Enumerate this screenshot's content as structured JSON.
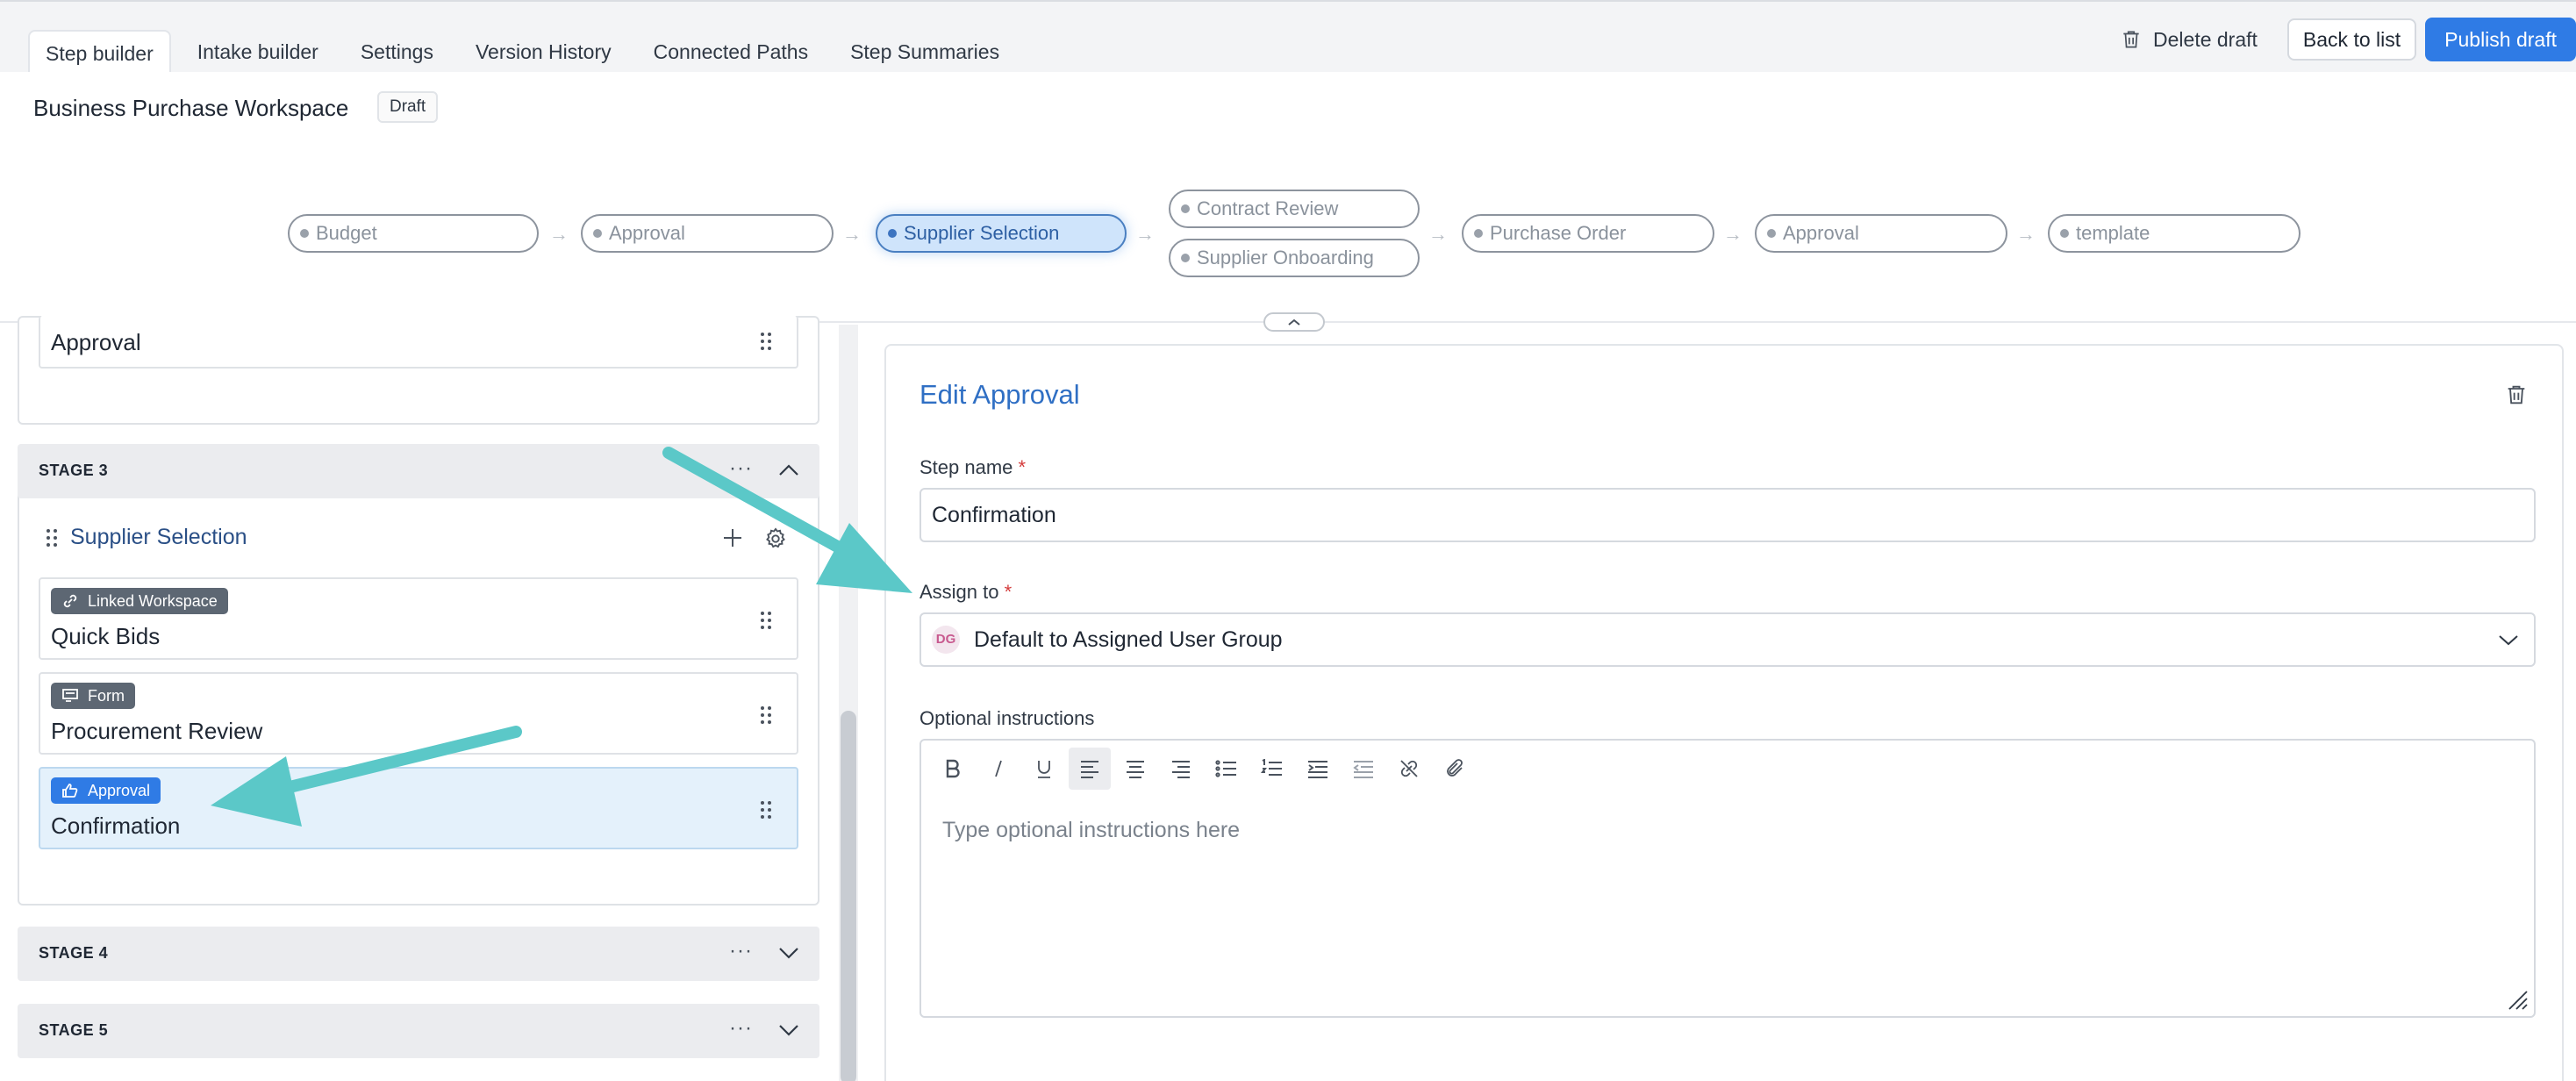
{
  "tabs": [
    {
      "label": "Step builder",
      "active": true
    },
    {
      "label": "Intake builder"
    },
    {
      "label": "Settings"
    },
    {
      "label": "Version History"
    },
    {
      "label": "Connected Paths"
    },
    {
      "label": "Step Summaries"
    }
  ],
  "actions": {
    "delete_draft": "Delete draft",
    "back_to_list": "Back to list",
    "publish_draft": "Publish draft"
  },
  "workspace": {
    "title": "Business Purchase Workspace",
    "status_badge": "Draft"
  },
  "flow": {
    "nodes": [
      {
        "label": "Budget"
      },
      {
        "label": "Approval"
      },
      {
        "label": "Supplier Selection",
        "active": true
      },
      {
        "label": "Contract Review"
      },
      {
        "label": "Supplier Onboarding"
      },
      {
        "label": "Purchase Order"
      },
      {
        "label": "Approval"
      },
      {
        "label": "template"
      }
    ]
  },
  "left_panel": {
    "prev_step_name": "Approval",
    "stage3": {
      "label": "STAGE 3",
      "group_title": "Supplier Selection",
      "steps": [
        {
          "badge": "Linked Workspace",
          "name": "Quick Bids",
          "icon": "link-icon"
        },
        {
          "badge": "Form",
          "name": "Procurement Review",
          "icon": "form-icon"
        },
        {
          "badge": "Approval",
          "name": "Confirmation",
          "icon": "thumbs-up-icon",
          "selected": true
        }
      ]
    },
    "stage4": {
      "label": "STAGE 4"
    },
    "stage5": {
      "label": "STAGE 5"
    }
  },
  "edit_panel": {
    "title": "Edit Approval",
    "step_name_label": "Step name",
    "step_name_value": "Confirmation",
    "assign_to_label": "Assign to",
    "assign_avatar": "DG",
    "assign_value": "Default to Assigned User Group",
    "instructions_label": "Optional instructions",
    "instructions_placeholder": "Type optional instructions here",
    "required_mark": "*"
  },
  "colors": {
    "accent": "#2f7be5",
    "annotation_arrow": "#5bc8c8",
    "title_blue": "#2f6fc4"
  }
}
